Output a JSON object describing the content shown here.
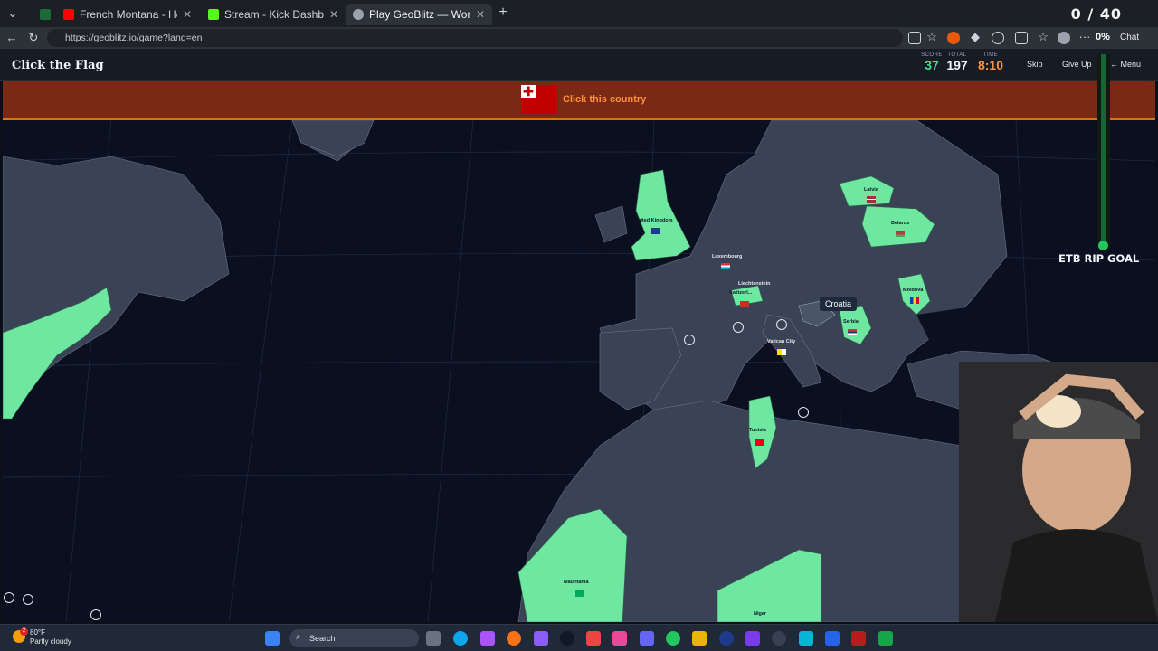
{
  "browser": {
    "tabs": [
      {
        "label": "French Montana - Hot Boy Bling ft.",
        "icon_color": "#ff0000"
      },
      {
        "label": "Stream - Kick Dashboard",
        "icon_color": "#53fc18"
      },
      {
        "label": "Play GeoBlitz — World Geography",
        "icon_color": "#9ca3af"
      }
    ],
    "url": "https://geoblitz.io/game?lang=en",
    "zoom_percent": "0%",
    "chat_label": "Chat",
    "overlay_counter": "0 / 40"
  },
  "game": {
    "title": "Click the Flag",
    "stats": [
      {
        "label": "SCORE",
        "value": "37",
        "color": "#4ade80"
      },
      {
        "label": "TOTAL",
        "value": "197",
        "color": "#f1f5f9"
      },
      {
        "label": "TIME",
        "value": "8:10",
        "color": "#fb923c"
      }
    ],
    "buttons": {
      "skip": "Skip",
      "give_up": "Give Up",
      "menu": "← Menu"
    },
    "prompt": {
      "text": "Click this country",
      "flag_name": "tonga-flag",
      "flag_color": "#c10000"
    },
    "hover_tooltip": "Croatia",
    "map_labels": {
      "united_kingdom": "United Kingdom",
      "latvia": "Latvia",
      "belarus": "Belarus",
      "luxembourg": "Luxembourg",
      "liechtenstein": "Liechtenstein",
      "switzerland": "Switzerl...",
      "moldova": "Moldova",
      "serbia": "Serbia",
      "vatican": "Vatican City",
      "tunisia": "Tunisia",
      "mauritania": "Mauritania",
      "niger": "Niger"
    },
    "colors": {
      "found": "#6ee7a0",
      "land": "#3a4356",
      "ocean": "#0b1020"
    }
  },
  "overlay": {
    "goal_label": "ETB RIP GOAL",
    "goal_progress": 0.98
  },
  "taskbar": {
    "weather_temp": "80°F",
    "weather_desc": "Partly cloudy",
    "weather_badge": "2",
    "search_placeholder": "Search"
  }
}
